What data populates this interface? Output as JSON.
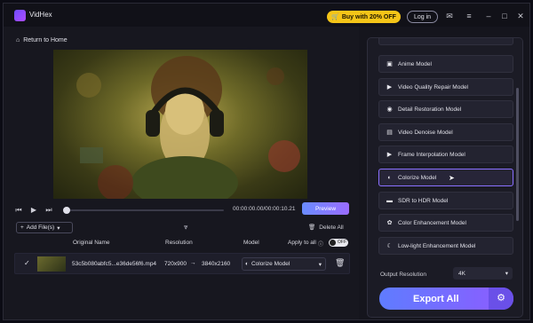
{
  "app": {
    "name": "VidHex"
  },
  "header": {
    "buy_label": "Buy with 20% OFF",
    "login_label": "Log in"
  },
  "nav": {
    "back_label": "Return to Home"
  },
  "player": {
    "time": "00:00:00.00/00:00:10.21",
    "preview_label": "Preview",
    "progress": 0
  },
  "toolbar": {
    "add_label": "Add File(s)",
    "delete_all_label": "Delete All"
  },
  "table": {
    "headers": {
      "name": "Original Name",
      "resolution": "Resolution",
      "model": "Model",
      "apply": "Apply to all"
    },
    "toggle_label": "OFF",
    "rows": [
      {
        "name": "53c5b080abfc5...e36de56f6.mp4",
        "res_from": "720x900",
        "res_to": "3840x2160",
        "model": "Colorize Model"
      }
    ]
  },
  "models": [
    {
      "label": "Anime Model",
      "icon": "anime-icon"
    },
    {
      "label": "Video Quality Repair Model",
      "icon": "video-repair-icon"
    },
    {
      "label": "Detail Restoration Model",
      "icon": "detail-restore-icon"
    },
    {
      "label": "Video Denoise Model",
      "icon": "denoise-icon"
    },
    {
      "label": "Frame Interpolation Model",
      "icon": "frame-interp-icon"
    },
    {
      "label": "Colorize Model",
      "icon": "colorize-icon",
      "selected": true
    },
    {
      "label": "SDR to HDR Model",
      "icon": "hdr-icon"
    },
    {
      "label": "Color Enhancement Model",
      "icon": "color-enhance-icon"
    },
    {
      "label": "Low-light Enhancement Model",
      "icon": "moon-icon"
    }
  ],
  "output": {
    "resolution_label": "Output Resolution",
    "resolution_value": "4K",
    "export_label": "Export All"
  },
  "colors": {
    "accent": "#8e5bff",
    "buy": "#f5c518"
  }
}
